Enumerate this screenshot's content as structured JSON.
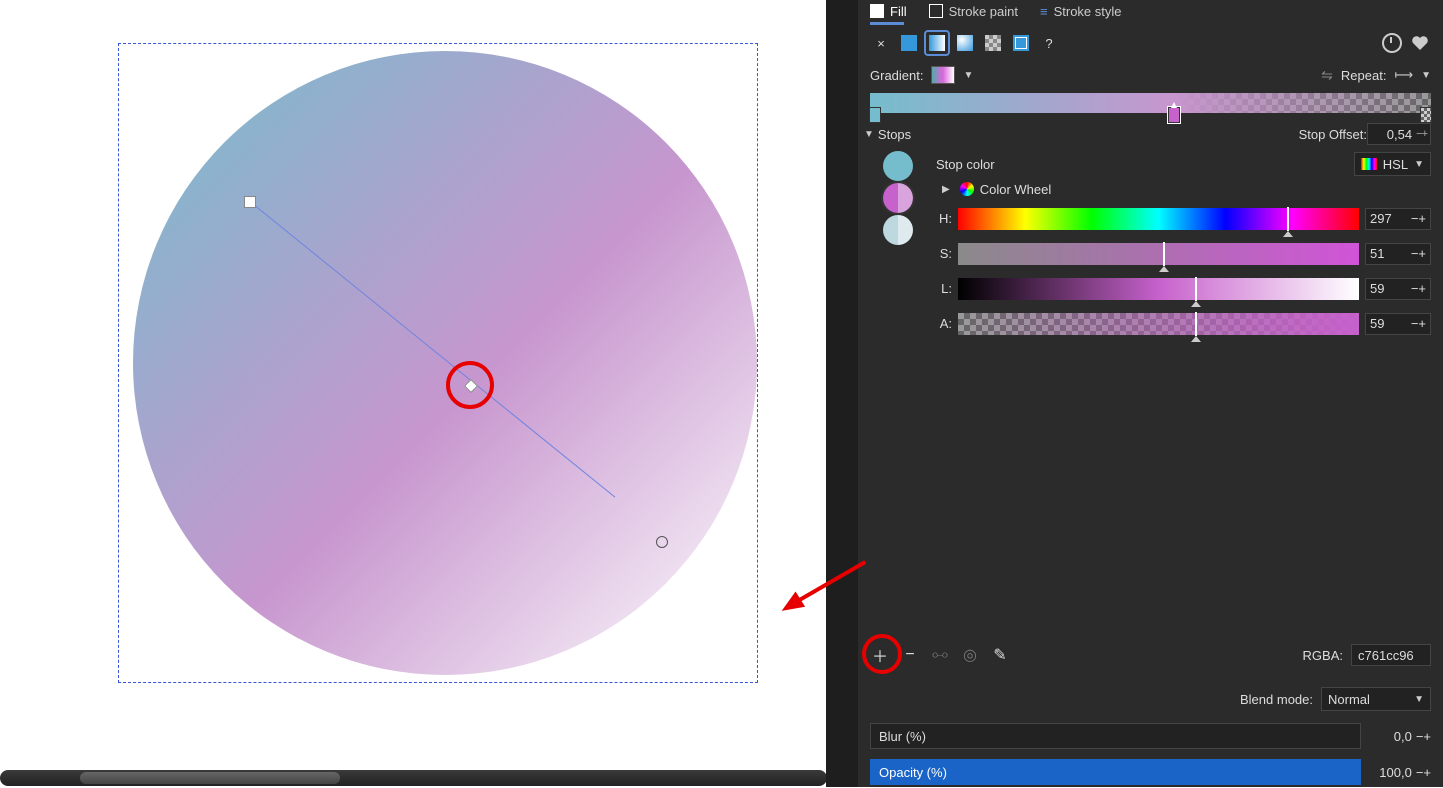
{
  "tabs": {
    "fill": "Fill",
    "stroke_paint": "Stroke paint",
    "stroke_style": "Stroke style"
  },
  "paint_type_icons": {
    "none": "×",
    "flat": "flat",
    "linear": "linear",
    "radial": "radial",
    "pattern": "pattern",
    "swatch": "swatch",
    "help": "?"
  },
  "gradient": {
    "label": "Gradient:",
    "reverse_title": "Reverse",
    "repeat_label": "Repeat:"
  },
  "stops": {
    "header": "Stops",
    "offset_label": "Stop Offset:",
    "offset_value": "0,54",
    "list": [
      {
        "color": "#75bdcc"
      },
      {
        "color": "#c761cc",
        "selected": true
      },
      {
        "color": "#bdd8df"
      }
    ]
  },
  "stop_color": {
    "label": "Stop color",
    "mode": "HSL",
    "wheel_label": "Color Wheel",
    "channels": {
      "H": {
        "label": "H:",
        "value": "297",
        "pos": 82
      },
      "S": {
        "label": "S:",
        "value": "51",
        "pos": 51
      },
      "L": {
        "label": "L:",
        "value": "59",
        "pos": 59
      },
      "A": {
        "label": "A:",
        "value": "59",
        "pos": 59
      }
    }
  },
  "rgba": {
    "label": "RGBA:",
    "value": "c761cc96"
  },
  "blend": {
    "label": "Blend mode:",
    "value": "Normal"
  },
  "blur": {
    "label": "Blur (%)",
    "value": "0,0"
  },
  "opacity": {
    "label": "Opacity (%)",
    "value": "100,0"
  },
  "annotations": {
    "arrow": "add-stop-callout"
  }
}
